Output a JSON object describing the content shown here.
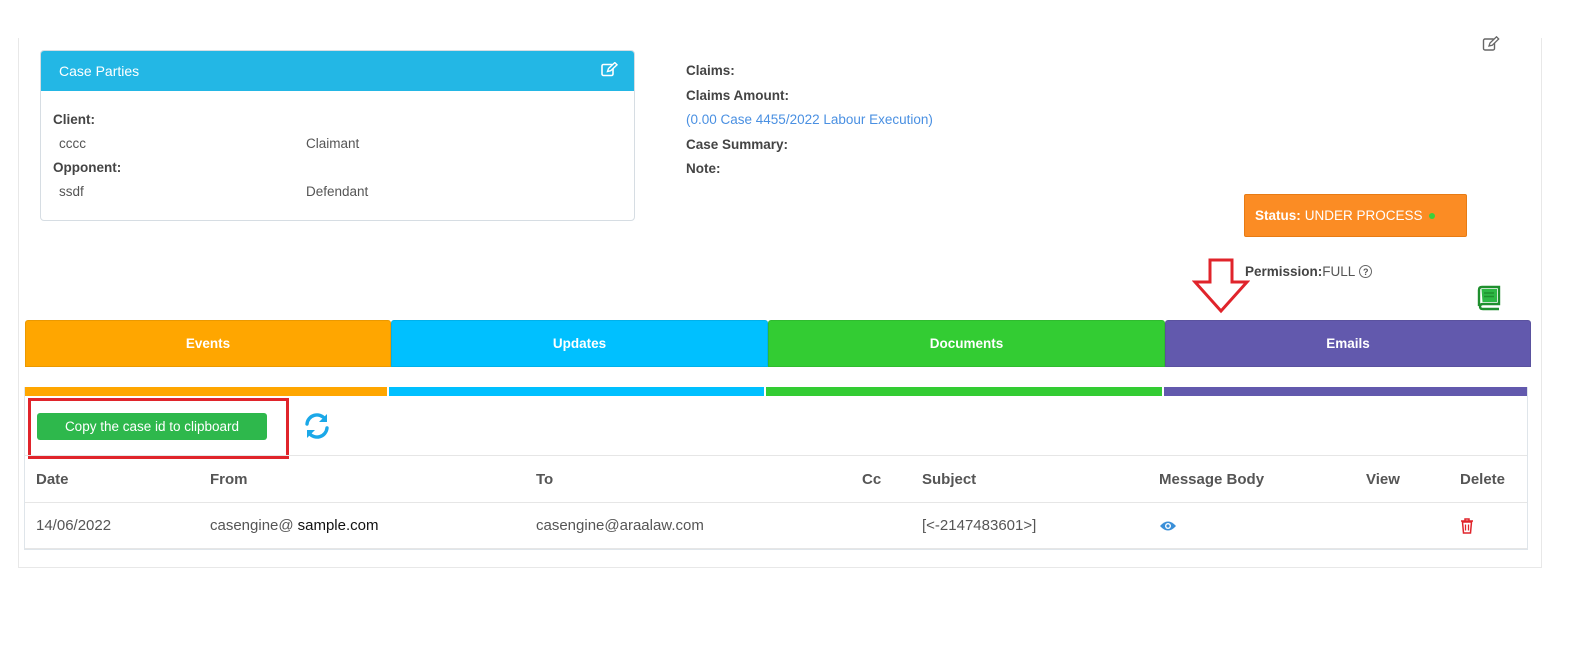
{
  "case_parties": {
    "title": "Case Parties",
    "client_label": "Client:",
    "client_name": "cccc",
    "client_role": "Claimant",
    "opponent_label": "Opponent:",
    "opponent_name": "ssdf",
    "opponent_role": "Defendant"
  },
  "info": {
    "claims_label": "Claims:",
    "claims_amount_label": "Claims Amount:",
    "claims_amount_link": "(0.00 Case 4455/2022 Labour Execution)",
    "case_summary_label": "Case Summary:",
    "note_label": "Note:"
  },
  "status": {
    "label": "Status:",
    "value": "UNDER PROCESS",
    "color": "#fb8c24"
  },
  "permission": {
    "label": "Permission:",
    "value": "FULL",
    "help_glyph": "?"
  },
  "tabs": [
    {
      "label": "Events",
      "color": "#ffa600"
    },
    {
      "label": "Updates",
      "color": "#00c0ff"
    },
    {
      "label": "Documents",
      "color": "#33cc33"
    },
    {
      "label": "Emails",
      "color": "#6259ad"
    }
  ],
  "toolbar": {
    "copy_label": "Copy the case id to clipboard",
    "refresh_icon": "refresh-icon"
  },
  "table": {
    "headers": [
      "Date",
      "From",
      "To",
      "Cc",
      "Subject",
      "Message Body",
      "View",
      "Delete"
    ],
    "rows": [
      {
        "date": "14/06/2022",
        "from_part1": "casengine@",
        "from_part2": "sample.com",
        "to": "casengine@araalaw.com",
        "cc": "",
        "subject": "[<-2147483601>]",
        "message_icon": "eye-icon",
        "delete_icon": "trash-icon"
      }
    ]
  },
  "colors": {
    "header_blue": "#23b7e5",
    "link_blue": "#4a90e2",
    "copy_green": "#2eb84c",
    "highlight_red": "#e0242b"
  }
}
